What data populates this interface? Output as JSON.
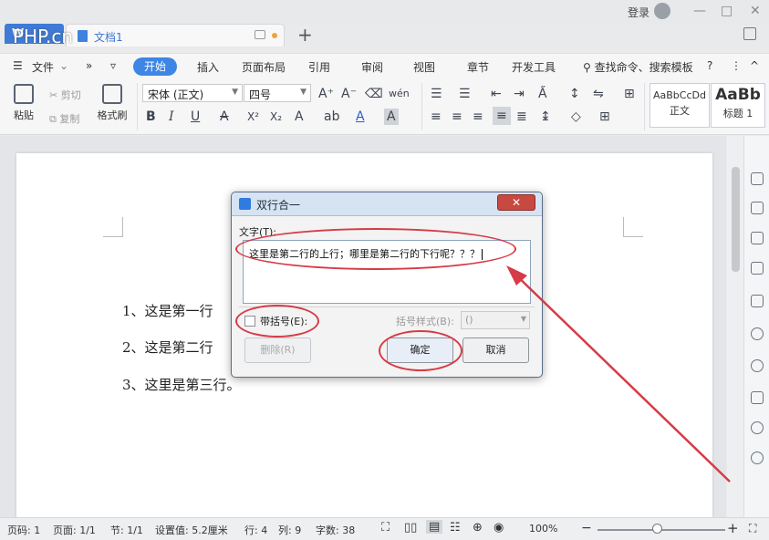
{
  "titlebar": {
    "watermark": "PHP.cn",
    "doc_tab_title": "文档1",
    "new_tab": "+",
    "login": "登录",
    "window_buttons": [
      "—",
      "□",
      "✕"
    ]
  },
  "menu": {
    "file": "文件",
    "expand_glyphs": [
      "»",
      "▿"
    ],
    "tabs": [
      "开始",
      "插入",
      "页面布局",
      "引用",
      "审阅",
      "视图",
      "章节",
      "开发工具"
    ],
    "search": "查找命令、搜索模板",
    "help": "?",
    "more": "⋮",
    "collapse": "^"
  },
  "ribbon": {
    "paste": "粘贴",
    "cut": "剪切",
    "copy": "复制",
    "format_painter": "格式刷",
    "font_name": "宋体 (正文)",
    "font_size": "四号",
    "bold": "B",
    "italic": "I",
    "underline": "U",
    "superscript": "X²",
    "subscript": "X₂",
    "styles": [
      {
        "sample": "AaBbCcDd",
        "name": "正文"
      },
      {
        "sample": "AaBb",
        "name": "标题 1"
      }
    ]
  },
  "document": {
    "lines": [
      "1、这是第一行",
      "2、这是第二行",
      "3、这里是第三行。"
    ]
  },
  "dialog": {
    "title": "双行合一",
    "close": "✕",
    "text_label": "文字(T):",
    "text_value": "这里是第二行的上行；哪里是第二行的下行呢？？？",
    "bracket_label": "带括号(E):",
    "bracket_checked": false,
    "bracket_style_label": "括号样式(B):",
    "bracket_style_value": "()",
    "delete_button": "删除(R)",
    "ok_button": "确定",
    "cancel_button": "取消"
  },
  "statusbar": {
    "page_num": "页码: 1",
    "pages": "页面: 1/1",
    "section": "节: 1/1",
    "setting": "设置值: 5.2厘米",
    "row": "行: 4",
    "col": "列: 9",
    "word_count": "字数: 38",
    "zoom": "100%",
    "zoom_minus": "−",
    "zoom_plus": "+"
  },
  "colors": {
    "accent": "#3d86e5",
    "annotation": "#d63b47"
  }
}
